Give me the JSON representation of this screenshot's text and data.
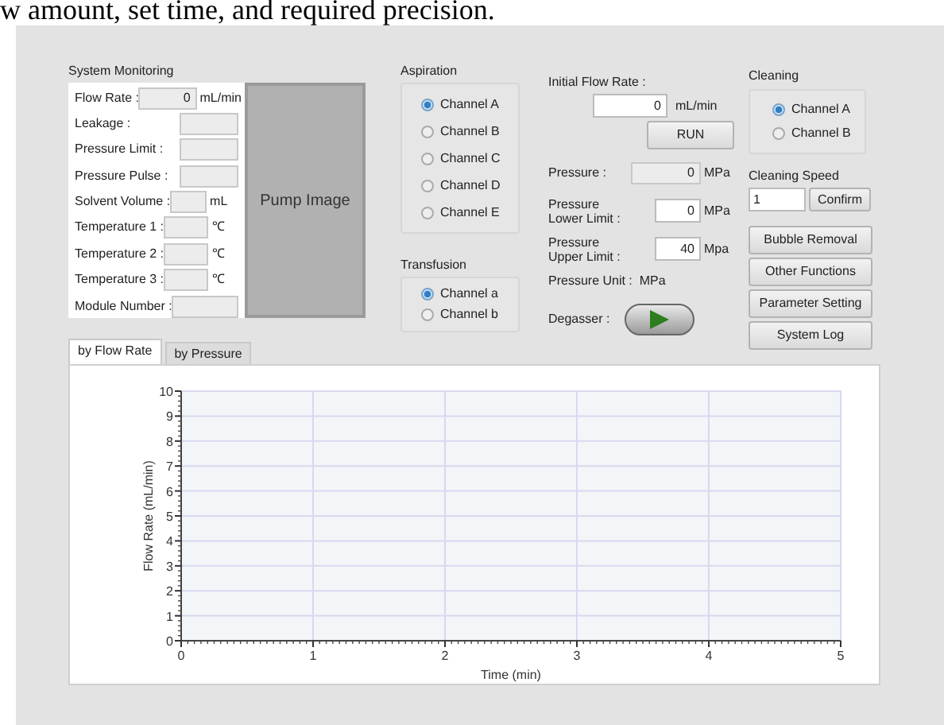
{
  "caption": "w amount, set time, and required precision.",
  "system_monitoring": {
    "title": "System Monitoring",
    "pump_image": "Pump Image",
    "fields": [
      {
        "label": "Flow Rate :",
        "value": "0",
        "unit": "mL/min",
        "kind": "wide"
      },
      {
        "label": "Leakage :",
        "kind": "plain"
      },
      {
        "label": "Pressure Limit :",
        "kind": "plain"
      },
      {
        "label": "Pressure Pulse :",
        "kind": "plain"
      },
      {
        "label": "Solvent Volume :",
        "unit": "mL",
        "kind": "short"
      },
      {
        "label": "Temperature  1 :",
        "unit": "℃",
        "kind": "temp"
      },
      {
        "label": "Temperature 2 :",
        "unit": "℃",
        "kind": "temp"
      },
      {
        "label": "Temperature 3 :",
        "unit": "℃",
        "kind": "temp"
      },
      {
        "label": "Module Number :",
        "kind": "long"
      }
    ]
  },
  "aspiration": {
    "title": "Aspiration",
    "options": [
      {
        "label": "Channel A",
        "selected": true
      },
      {
        "label": "Channel B",
        "selected": false
      },
      {
        "label": "Channel C",
        "selected": false
      },
      {
        "label": "Channel D",
        "selected": false
      },
      {
        "label": "Channel E",
        "selected": false
      }
    ]
  },
  "transfusion": {
    "title": "Transfusion",
    "options": [
      {
        "label": "Channel a",
        "selected": true
      },
      {
        "label": "Channel b",
        "selected": false
      }
    ]
  },
  "flow_control": {
    "initial_label": "Initial Flow Rate :",
    "initial_value": "0",
    "initial_unit": "mL/min",
    "run_button": "RUN",
    "rows": [
      {
        "label": "Pressure :",
        "value": "0",
        "unit": "MPa",
        "readonly": true
      },
      {
        "label": "Pressure\nLower Limit :",
        "value": "0",
        "unit": "MPa",
        "readonly": false
      },
      {
        "label": "Pressure\nUpper Limit :",
        "value": "40",
        "unit": "Mpa",
        "readonly": false
      }
    ],
    "pressure_unit": "Pressure Unit :  MPa",
    "degasser_label": "Degasser :",
    "degasser_on": true
  },
  "cleaning": {
    "title": "Cleaning",
    "options": [
      {
        "label": "Channel A",
        "selected": true
      },
      {
        "label": "Channel B",
        "selected": false
      }
    ],
    "speed_label": "Cleaning Speed",
    "speed_value": "1",
    "confirm_button": "Confirm",
    "buttons": [
      "Bubble Removal",
      "Other Functions",
      "Parameter Setting",
      "System Log"
    ]
  },
  "tabs": [
    {
      "label": "by Flow Rate",
      "selected": true
    },
    {
      "label": "by Pressure",
      "selected": false
    }
  ],
  "chart": {
    "chart_data": {
      "type": "line",
      "grid": true,
      "xlabel": "Time (min)",
      "ylabel": "Flow Rate (mL/min)",
      "xlim": [
        0,
        5
      ],
      "ylim": [
        0,
        10
      ],
      "xticks": [
        0,
        1,
        2,
        3,
        4,
        5
      ],
      "yticks": [
        0,
        1,
        2,
        3,
        4,
        5,
        6,
        7,
        8,
        9,
        10
      ]
    }
  }
}
